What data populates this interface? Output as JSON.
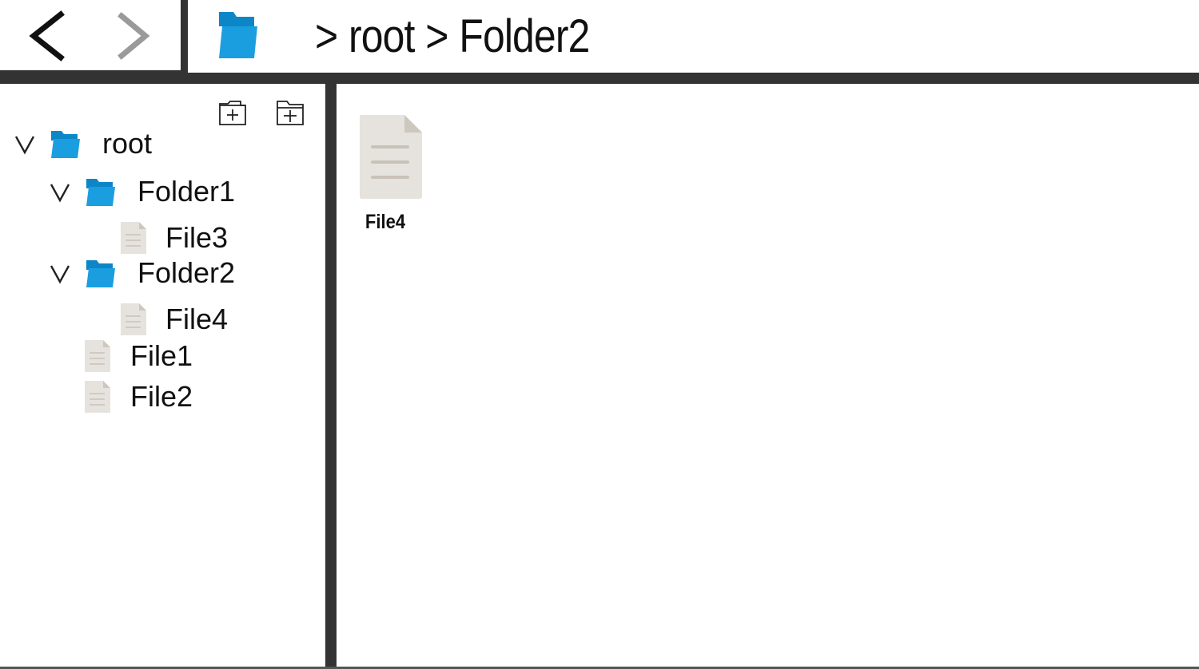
{
  "toolbar": {
    "back_icon": "chevron-left-icon",
    "forward_icon": "chevron-right-icon",
    "address_icon": "folder-icon"
  },
  "breadcrumb": {
    "segments": [
      ">",
      "root",
      ">",
      "Folder2"
    ]
  },
  "sidebar": {
    "actions": [
      {
        "icon": "new-file-icon"
      },
      {
        "icon": "new-folder-icon"
      }
    ],
    "tree": [
      {
        "type": "folder",
        "label": "root",
        "expanded": true
      },
      {
        "type": "folder",
        "label": "Folder1",
        "expanded": true
      },
      {
        "type": "file",
        "label": "File3"
      },
      {
        "type": "folder",
        "label": "Folder2",
        "expanded": true
      },
      {
        "type": "file",
        "label": "File4"
      },
      {
        "type": "file",
        "label": "File1"
      },
      {
        "type": "file",
        "label": "File2"
      }
    ]
  },
  "content": {
    "items": [
      {
        "type": "file",
        "label": "File4"
      }
    ]
  },
  "colors": {
    "folder_blue": "#1a9ee0",
    "folder_blue_dark": "#0d86c8",
    "file_gray": "#e6e3df",
    "file_fold": "#cdc7be",
    "file_lines": "#c9c2b8",
    "divider": "#333333"
  }
}
